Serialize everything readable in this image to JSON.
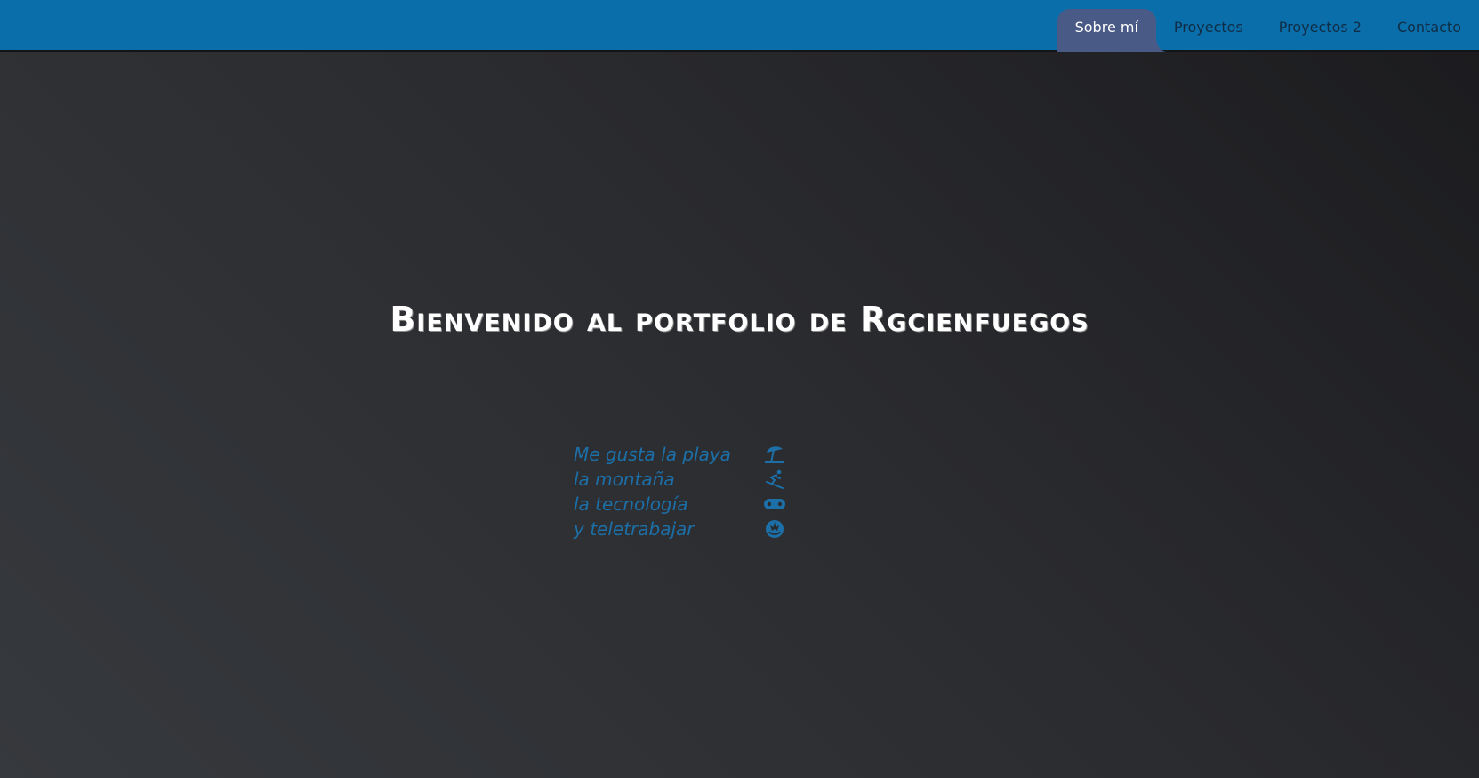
{
  "nav": {
    "items": [
      {
        "label": "Sobre mí",
        "active": true
      },
      {
        "label": "Proyectos",
        "active": false
      },
      {
        "label": "Proyectos 2",
        "active": false
      },
      {
        "label": "Contacto",
        "active": false
      }
    ]
  },
  "hero": {
    "title": "Bienvenido al portfolio de Rgcienfuegos"
  },
  "likes": [
    {
      "text": "Me gusta la playa",
      "icon": "umbrella-beach-icon"
    },
    {
      "text": "la montaña",
      "icon": "skiing-icon"
    },
    {
      "text": "la tecnología",
      "icon": "gamepad-icon"
    },
    {
      "text": "y teletrabajar",
      "icon": "rebel-alliance-icon"
    }
  ],
  "colors": {
    "header": "#0a6eab",
    "active_tab": "#4a5a86",
    "accent_text": "#1c6fa7",
    "background_dark": "#1b1b1e"
  }
}
